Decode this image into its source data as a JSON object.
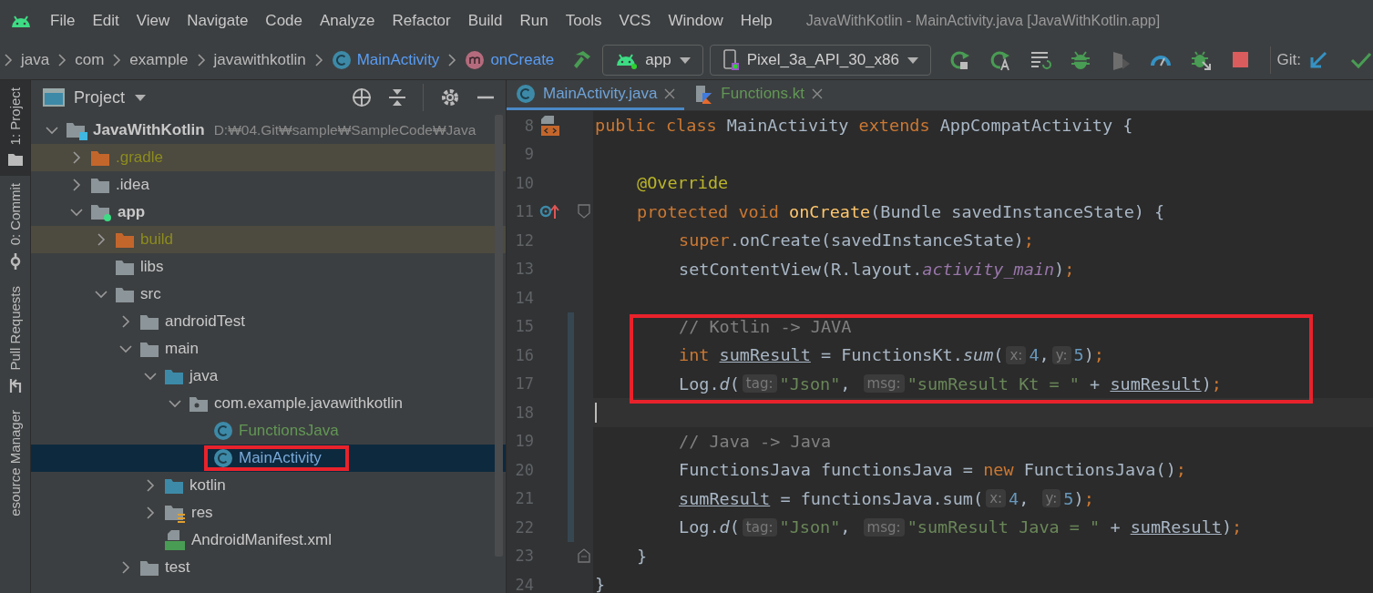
{
  "menu_bar": {
    "items": [
      "File",
      "Edit",
      "View",
      "Navigate",
      "Code",
      "Analyze",
      "Refactor",
      "Build",
      "Run",
      "Tools",
      "VCS",
      "Window",
      "Help"
    ],
    "window_title": "JavaWithKotlin - MainActivity.java [JavaWithKotlin.app]"
  },
  "nav_bar": {
    "breadcrumbs": [
      {
        "label": "java",
        "kind": "folder"
      },
      {
        "label": "com",
        "kind": "folder"
      },
      {
        "label": "example",
        "kind": "folder"
      },
      {
        "label": "javawithkotlin",
        "kind": "folder"
      },
      {
        "label": "MainActivity",
        "kind": "class"
      },
      {
        "label": "onCreate",
        "kind": "method"
      }
    ],
    "run_config": "app",
    "device": "Pixel_3a_API_30_x86",
    "git_label": "Git:"
  },
  "tool_strip": [
    {
      "label": "1: Project",
      "kind": "project",
      "selected": true
    },
    {
      "label": "0: Commit",
      "kind": "commit",
      "selected": false
    },
    {
      "label": "Pull Requests",
      "kind": "pull",
      "selected": false
    },
    {
      "label": "esource Manager",
      "kind": "none",
      "selected": false
    }
  ],
  "project_panel": {
    "title": "Project",
    "tree": [
      {
        "label": "JavaWithKotlin",
        "path": "D:₩04.Git₩sample₩SampleCode₩Java",
        "kind": "project",
        "expanded": true,
        "selected": false,
        "children": [
          {
            "label": ".gradle",
            "kind": "excluded",
            "expanded": false,
            "selected": false
          },
          {
            "label": ".idea",
            "kind": "folder",
            "expanded": false,
            "selected": false
          },
          {
            "label": "app",
            "kind": "module",
            "expanded": true,
            "selected": false,
            "children": [
              {
                "label": "build",
                "kind": "excluded",
                "expanded": false,
                "selected": false
              },
              {
                "label": "libs",
                "kind": "folder",
                "selected": false
              },
              {
                "label": "src",
                "kind": "folder",
                "expanded": true,
                "selected": false,
                "children": [
                  {
                    "label": "androidTest",
                    "kind": "folder",
                    "expanded": false,
                    "selected": false
                  },
                  {
                    "label": "main",
                    "kind": "folder",
                    "expanded": true,
                    "selected": false,
                    "children": [
                      {
                        "label": "java",
                        "kind": "source",
                        "expanded": true,
                        "selected": false,
                        "children": [
                          {
                            "label": "com.example.javawithkotlin",
                            "kind": "package",
                            "expanded": true,
                            "selected": false,
                            "children": [
                              {
                                "label": "FunctionsJava",
                                "kind": "class",
                                "color": "#629755",
                                "selected": false
                              },
                              {
                                "label": "MainActivity",
                                "kind": "class",
                                "selected": true,
                                "boxed": true
                              }
                            ]
                          }
                        ]
                      },
                      {
                        "label": "kotlin",
                        "kind": "source",
                        "expanded": false,
                        "selected": false
                      },
                      {
                        "label": "res",
                        "kind": "res",
                        "expanded": false,
                        "selected": false
                      },
                      {
                        "label": "AndroidManifest.xml",
                        "kind": "manifest",
                        "selected": false
                      }
                    ]
                  },
                  {
                    "label": "test",
                    "kind": "folder",
                    "expanded": false,
                    "selected": false
                  }
                ]
              }
            ]
          }
        ]
      }
    ]
  },
  "editor": {
    "tabs": [
      {
        "label": "MainActivity.java",
        "kind": "java",
        "selected": true
      },
      {
        "label": "Functions.kt",
        "kind": "kotlin",
        "color": "#629755",
        "selected": false
      }
    ],
    "lines": [
      {
        "number": "8",
        "kind": "class",
        "gutter_icon": {
          "kind": "layout"
        },
        "tokens": [
          {
            "kind": "kw",
            "text": "public class "
          },
          {
            "kind": "t",
            "text": "MainActivity "
          },
          {
            "kind": "kw",
            "text": "extends "
          },
          {
            "kind": "t",
            "text": "AppCompatActivity {"
          }
        ]
      },
      {
        "number": "9"
      },
      {
        "number": "10",
        "kind": "member",
        "tokens": [
          {
            "kind": "ann",
            "text": "@Override"
          }
        ]
      },
      {
        "number": "11",
        "kind": "member",
        "gutter_icon": {
          "kind": "override"
        },
        "fold": {
          "kind": "start"
        },
        "tokens": [
          {
            "kind": "kw",
            "text": "protected void "
          },
          {
            "kind": "fn",
            "text": "onCreate"
          },
          {
            "kind": "t",
            "text": "(Bundle savedInstanceState) {"
          }
        ]
      },
      {
        "number": "12",
        "kind": "statement",
        "tokens": [
          {
            "kind": "kw",
            "text": "super"
          },
          {
            "kind": "t",
            "text": ".onCreate(savedInstanceState)"
          },
          {
            "kind": "kw",
            "text": ";"
          }
        ]
      },
      {
        "number": "13",
        "kind": "statement",
        "tokens": [
          {
            "kind": "t",
            "text": "setContentView(R.layout."
          },
          {
            "kind": "fld",
            "text": "activity_main"
          },
          {
            "kind": "t",
            "text": ")"
          },
          {
            "kind": "kw",
            "text": ";"
          }
        ]
      },
      {
        "number": "14"
      },
      {
        "number": "15",
        "kind": "statement",
        "modified": true,
        "boxed": true,
        "tokens": [
          {
            "kind": "cm",
            "text": "// Kotlin -> JAVA"
          }
        ]
      },
      {
        "number": "16",
        "kind": "statement",
        "modified": true,
        "boxed": true,
        "tokens": [
          {
            "kind": "kw",
            "text": "int "
          },
          {
            "kind": "ul",
            "text": "sumResult"
          },
          {
            "kind": "t",
            "text": " = FunctionsKt."
          },
          {
            "kind": "it",
            "text": "sum"
          },
          {
            "kind": "t",
            "text": "("
          },
          {
            "kind": "hint",
            "text": "x:"
          },
          {
            "kind": "num",
            "text": "4"
          },
          {
            "kind": "t",
            "text": ","
          },
          {
            "kind": "hint",
            "text": "y:"
          },
          {
            "kind": "num",
            "text": "5"
          },
          {
            "kind": "t",
            "text": ")"
          },
          {
            "kind": "kw",
            "text": ";"
          }
        ]
      },
      {
        "number": "17",
        "kind": "statement",
        "modified": true,
        "boxed": true,
        "tokens": [
          {
            "kind": "t",
            "text": "Log."
          },
          {
            "kind": "it",
            "text": "d"
          },
          {
            "kind": "t",
            "text": "("
          },
          {
            "kind": "hint",
            "text": "tag:"
          },
          {
            "kind": "str",
            "text": "\"Json\""
          },
          {
            "kind": "t",
            "text": ", "
          },
          {
            "kind": "hint",
            "text": "msg:"
          },
          {
            "kind": "str",
            "text": "\"sumResult Kt = \""
          },
          {
            "kind": "t",
            "text": " + "
          },
          {
            "kind": "ul",
            "text": "sumResult"
          },
          {
            "kind": "t",
            "text": ")"
          },
          {
            "kind": "kw",
            "text": ";"
          }
        ]
      },
      {
        "number": "18",
        "modified": true,
        "current": true
      },
      {
        "number": "19",
        "kind": "statement",
        "modified": true,
        "tokens": [
          {
            "kind": "cm",
            "text": "// Java -> Java"
          }
        ]
      },
      {
        "number": "20",
        "kind": "statement",
        "modified": true,
        "tokens": [
          {
            "kind": "t",
            "text": "FunctionsJava functionsJava = "
          },
          {
            "kind": "kw",
            "text": "new "
          },
          {
            "kind": "t",
            "text": "FunctionsJava()"
          },
          {
            "kind": "kw",
            "text": ";"
          }
        ]
      },
      {
        "number": "21",
        "kind": "statement",
        "modified": true,
        "tokens": [
          {
            "kind": "ul",
            "text": "sumResult"
          },
          {
            "kind": "t",
            "text": " = functionsJava.sum("
          },
          {
            "kind": "hint",
            "text": "x:"
          },
          {
            "kind": "num",
            "text": "4"
          },
          {
            "kind": "t",
            "text": ", "
          },
          {
            "kind": "hint",
            "text": "y:"
          },
          {
            "kind": "num",
            "text": "5"
          },
          {
            "kind": "t",
            "text": ")"
          },
          {
            "kind": "kw",
            "text": ";"
          }
        ]
      },
      {
        "number": "22",
        "kind": "statement",
        "modified": true,
        "tokens": [
          {
            "kind": "t",
            "text": "Log."
          },
          {
            "kind": "it",
            "text": "d"
          },
          {
            "kind": "t",
            "text": "("
          },
          {
            "kind": "hint",
            "text": "tag:"
          },
          {
            "kind": "str",
            "text": "\"Json\""
          },
          {
            "kind": "t",
            "text": ", "
          },
          {
            "kind": "hint",
            "text": "msg:"
          },
          {
            "kind": "str",
            "text": "\"sumResult Java = \""
          },
          {
            "kind": "t",
            "text": " + "
          },
          {
            "kind": "ul",
            "text": "sumResult"
          },
          {
            "kind": "t",
            "text": ")"
          },
          {
            "kind": "kw",
            "text": ";"
          }
        ]
      },
      {
        "number": "23",
        "kind": "member",
        "fold": {
          "kind": "end"
        },
        "tokens": [
          {
            "kind": "t",
            "text": "}"
          }
        ]
      },
      {
        "number": "24",
        "kind": "class",
        "tokens": [
          {
            "kind": "t",
            "text": "}"
          }
        ]
      }
    ]
  }
}
